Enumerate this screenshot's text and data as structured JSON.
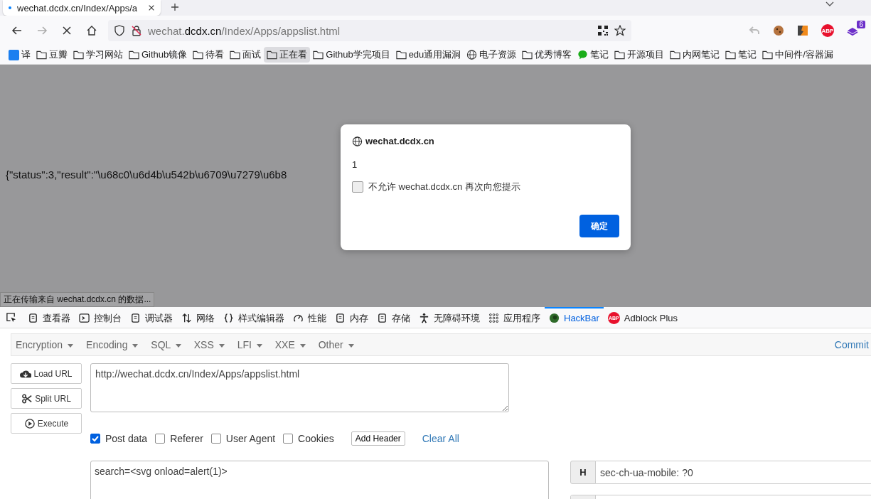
{
  "browser_tab": {
    "title": "wechat.dcdx.cn/Index/Apps/a"
  },
  "address_bar": {
    "prefix": "wechat.",
    "domain": "dcdx.cn",
    "path": "/Index/Apps/appslist.html"
  },
  "extensions": {
    "abp_label": "ABP",
    "badge": "6"
  },
  "bookmarks": [
    {
      "label": "译",
      "kind": "translate",
      "selected": false
    },
    {
      "label": "豆瓣",
      "kind": "folder",
      "selected": false
    },
    {
      "label": "学习网站",
      "kind": "folder",
      "selected": false
    },
    {
      "label": "Github镜像",
      "kind": "folder",
      "selected": false
    },
    {
      "label": "待看",
      "kind": "folder",
      "selected": false
    },
    {
      "label": "面试",
      "kind": "folder",
      "selected": false
    },
    {
      "label": "正在看",
      "kind": "folder",
      "selected": true
    },
    {
      "label": "Github学完项目",
      "kind": "folder",
      "selected": false
    },
    {
      "label": "edu通用漏洞",
      "kind": "folder",
      "selected": false
    },
    {
      "label": "电子资源",
      "kind": "globe",
      "selected": false
    },
    {
      "label": "优秀博客",
      "kind": "folder",
      "selected": false
    },
    {
      "label": "笔记",
      "kind": "chat",
      "selected": false
    },
    {
      "label": "开源项目",
      "kind": "folder",
      "selected": false
    },
    {
      "label": "内网笔记",
      "kind": "folder",
      "selected": false
    },
    {
      "label": "笔记",
      "kind": "folder",
      "selected": false
    },
    {
      "label": "中间件/容器漏",
      "kind": "folder",
      "selected": false
    }
  ],
  "page": {
    "response_text": "{\"status\":3,\"result\":\"\\u68c0\\u6d4b\\u542b\\u6709\\u7279\\u6b8"
  },
  "alert_dialog": {
    "title": "wechat.dcdx.cn",
    "message": "1",
    "suppress_label": "不允许 wechat.dcdx.cn 再次向您提示",
    "suppress_checked": false,
    "ok": "确定"
  },
  "status_bar": "正在传输来自 wechat.dcdx.cn 的数据...",
  "devtools_tabs": [
    {
      "label": "查看器",
      "kind": "inspector",
      "selected": false
    },
    {
      "label": "控制台",
      "kind": "console",
      "selected": false
    },
    {
      "label": "调试器",
      "kind": "debugger",
      "selected": false
    },
    {
      "label": "网络",
      "kind": "network",
      "selected": false
    },
    {
      "label": "样式编辑器",
      "kind": "style",
      "selected": false
    },
    {
      "label": "性能",
      "kind": "performance",
      "selected": false
    },
    {
      "label": "内存",
      "kind": "memory",
      "selected": false
    },
    {
      "label": "存储",
      "kind": "storage",
      "selected": false
    },
    {
      "label": "无障碍环境",
      "kind": "accessibility",
      "selected": false
    },
    {
      "label": "应用程序",
      "kind": "application",
      "selected": false
    },
    {
      "label": "HackBar",
      "kind": "hackbar",
      "selected": true
    },
    {
      "label": "Adblock Plus",
      "kind": "abp",
      "selected": false,
      "icon_label": "ABP"
    }
  ],
  "hackbar": {
    "menus": [
      "Encryption",
      "Encoding",
      "SQL",
      "XSS",
      "LFI",
      "XXE",
      "Other"
    ],
    "commit": "Commit",
    "actions": [
      {
        "label": "Load URL",
        "kind": "load"
      },
      {
        "label": "Split URL",
        "kind": "split"
      },
      {
        "label": "Execute",
        "kind": "execute"
      }
    ],
    "url": "http://wechat.dcdx.cn/Index/Apps/appslist.html",
    "options": [
      {
        "label": "Post data",
        "checked": true
      },
      {
        "label": "Referer",
        "checked": false
      },
      {
        "label": "User Agent",
        "checked": false
      },
      {
        "label": "Cookies",
        "checked": false
      }
    ],
    "add_header": "Add Header",
    "clear_all": "Clear All",
    "post_body": "search=<svg onload=alert(1)>",
    "headers": [
      {
        "tag": "H",
        "value": "sec-ch-ua-mobile: ?0"
      }
    ]
  }
}
